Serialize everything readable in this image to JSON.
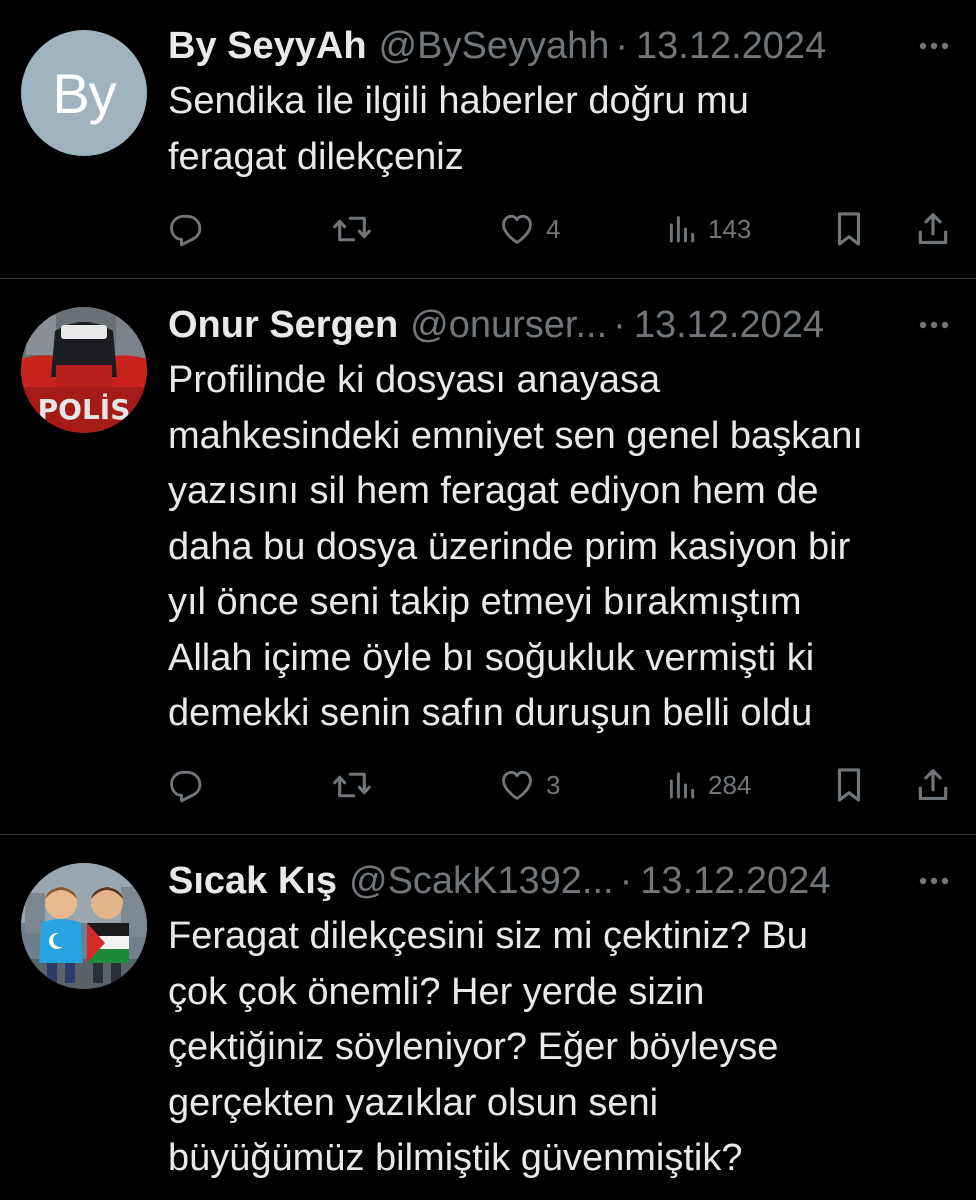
{
  "tweets": [
    {
      "avatar_text": "By",
      "avatar_color": "#9fb3bf",
      "name": "By SeyyAh",
      "handle": "@BySeyyahh",
      "separator": "·",
      "date": "13.12.2024",
      "lines": [
        "Sendika ile ilgili haberler doğru mu",
        "feragat dilekçeniz"
      ],
      "likes": "4",
      "views": "143"
    },
    {
      "avatar_icon": "police-avatar",
      "avatar_text": "POLİS",
      "name": "Onur Sergen",
      "handle": "@onurser...",
      "separator": "·",
      "date": "13.12.2024",
      "lines": [
        "Profilinde ki dosyası anayasa",
        "mahkesindeki emniyet sen genel başkanı",
        "yazısını sil hem feragat ediyon hem de",
        "daha bu dosya üzerinde prim kasiyon bir",
        "yıl önce seni takip etmeyi bırakmıştım",
        "Allah içime öyle bı soğukluk vermişti ki",
        "demekki senin safın duruşun belli oldu"
      ],
      "likes": "3",
      "views": "284"
    },
    {
      "avatar_icon": "two-children-flags-avatar",
      "name": "Sıcak Kış",
      "handle": "@ScakK1392...",
      "separator": "·",
      "date": "13.12.2024",
      "lines": [
        "Feragat dilekçesini siz mi çektiniz? Bu",
        "çok çok önemli? Her yerde sizin",
        "çektiğiniz söyleniyor? Eğer böyleyse",
        "gerçekten yazıklar olsun seni",
        "büyüğümüz bilmiştik güvenmiştik?"
      ]
    }
  ],
  "icons": {
    "more": "more-icon",
    "reply": "reply-icon",
    "retweet": "retweet-icon",
    "like": "heart-icon",
    "views": "views-icon",
    "bookmark": "bookmark-icon",
    "share": "share-icon"
  },
  "colors": {
    "background": "#000000",
    "text": "#e7e9ea",
    "secondary": "#71767b",
    "divider": "#2f3336"
  }
}
